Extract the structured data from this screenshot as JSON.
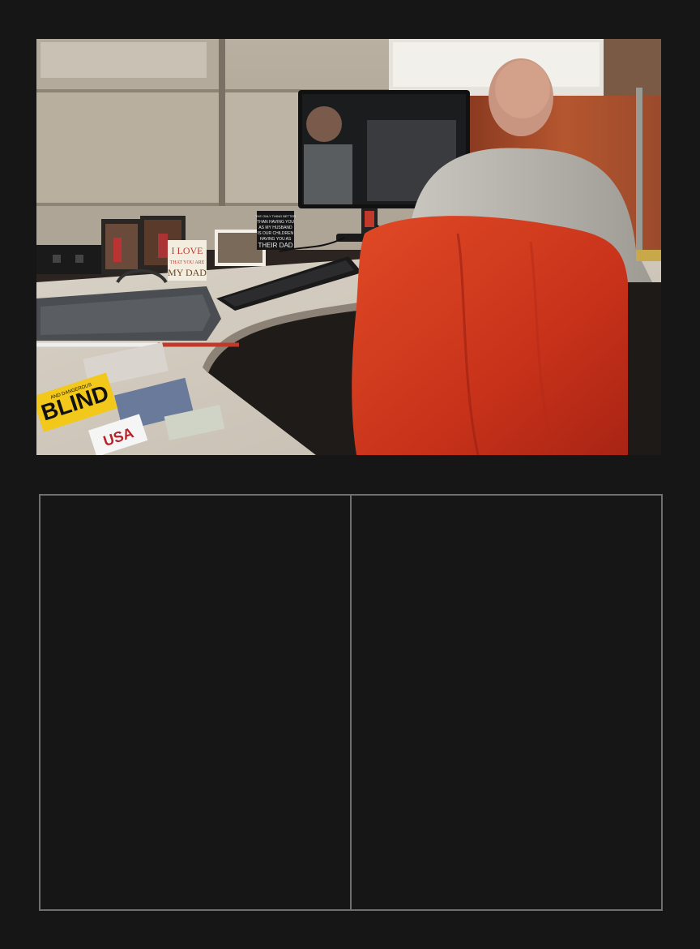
{
  "photo": {
    "sign_love": [
      "I LOVE",
      "THAT YOU ARE",
      "MY DAD"
    ],
    "sign_quote": [
      "THE ONLY THING BETTER",
      "THAN HAVING YOU",
      "AS MY HUSBAND",
      "IS OUR CHILDREN",
      "HAVING YOU AS",
      "THEIR DAD"
    ],
    "sticker_blind": "BLIND",
    "sticker_blind_small": "AND DANGEROUS",
    "sticker_usa": "USA"
  },
  "colors": {
    "background": "#161616",
    "panel_border": "#6f6f6f",
    "jacket": "#d23a1c",
    "partition": "#c8bfb0",
    "wood": "#9a4a2c"
  }
}
